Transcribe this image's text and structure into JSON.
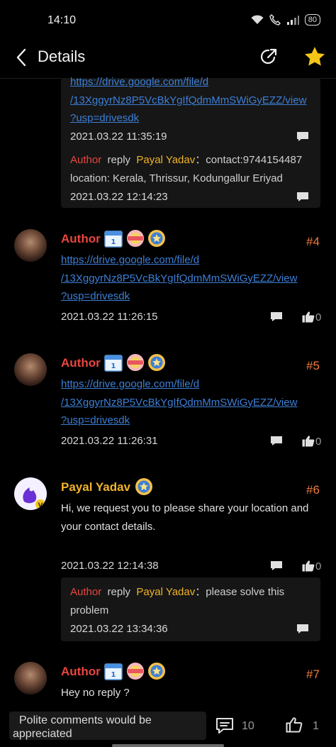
{
  "status": {
    "time": "14:10",
    "battery": "80"
  },
  "header": {
    "title": "Details"
  },
  "top_reply": {
    "link_lines": [
      "https://drive.google.com/file/d",
      "/13XggyrNz8P5VcBkYgIfQdmMmSWiGyEZZ/view",
      "?usp=drivesdk"
    ],
    "timestamp1": "2021.03.22 11:35:19",
    "reply_author": "Author",
    "reply_word": "reply",
    "reply_target": "Payal Yadav",
    "reply_colon": "：",
    "reply_text_line1": "contact:9744154487",
    "reply_text_line2": "location: Kerala, Thrissur, Kodungallur Eriyad",
    "timestamp2": "2021.03.22 12:14:23"
  },
  "comments": [
    {
      "name": "Author",
      "floor": "#4",
      "link_lines": [
        "https://drive.google.com/file/d",
        "/13XggyrNz8P5VcBkYgIfQdmMmSWiGyEZZ/view",
        "?usp=drivesdk"
      ],
      "timestamp": "2021.03.22 11:26:15",
      "likes": "0"
    },
    {
      "name": "Author",
      "floor": "#5",
      "link_lines": [
        "https://drive.google.com/file/d",
        "/13XggyrNz8P5VcBkYgIfQdmMmSWiGyEZZ/view",
        "?usp=drivesdk"
      ],
      "timestamp": "2021.03.22 11:26:31",
      "likes": "0"
    },
    {
      "name": "Payal Yadav",
      "floor": "#6",
      "text_line1": "Hi, we request you to please share your location and",
      "text_line2": "your contact details.",
      "timestamp": "2021.03.22 12:14:38",
      "likes": "0",
      "reply": {
        "author": "Author",
        "word": "reply",
        "target": "Payal Yadav",
        "colon": "：",
        "text_line1": "please solve this",
        "text_line2": "problem",
        "timestamp": "2021.03.22 13:34:36"
      }
    },
    {
      "name": "Author",
      "floor": "#7",
      "text_line1": "Hey no reply ?"
    }
  ],
  "bottom_bar": {
    "placeholder_line1": "Polite comments would be",
    "placeholder_line2": "appreciated",
    "comment_count": "10",
    "like_count": "1"
  },
  "colors": {
    "author": "#e84640",
    "payal": "#f0b429",
    "floor": "#f07a3a",
    "link": "#3d7fd6"
  }
}
